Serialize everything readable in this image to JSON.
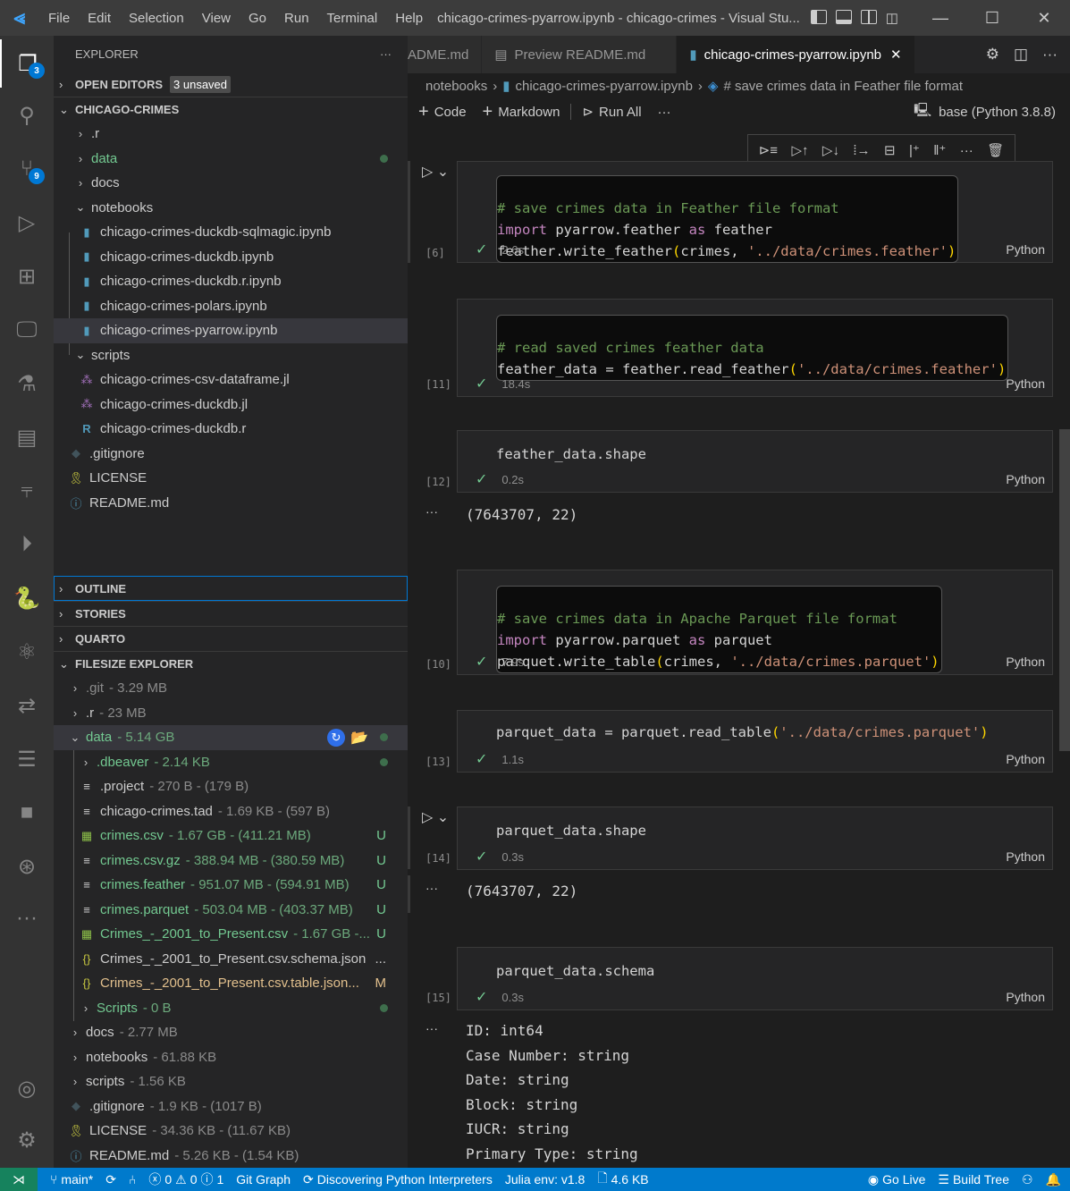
{
  "titlebar": {
    "menu": [
      "File",
      "Edit",
      "Selection",
      "View",
      "Go",
      "Run",
      "Terminal",
      "Help"
    ],
    "title": "chicago-crimes-pyarrow.ipynb - chicago-crimes - Visual Stu..."
  },
  "activity_bar": {
    "explorer_badge": "3",
    "scm_badge": "9"
  },
  "sidebar": {
    "header": "EXPLORER",
    "open_editors": {
      "label": "OPEN EDITORS",
      "badge": "3 unsaved"
    },
    "root": "CHICAGO-CRIMES",
    "tree": [
      {
        "name": ".r",
        "type": "folder"
      },
      {
        "name": "data",
        "type": "folder",
        "status": "dot"
      },
      {
        "name": "docs",
        "type": "folder"
      },
      {
        "name": "notebooks",
        "type": "folder-open"
      },
      {
        "name": "chicago-crimes-duckdb-sqlmagic.ipynb",
        "type": "notebook"
      },
      {
        "name": "chicago-crimes-duckdb.ipynb",
        "type": "notebook"
      },
      {
        "name": "chicago-crimes-duckdb.r.ipynb",
        "type": "notebook"
      },
      {
        "name": "chicago-crimes-polars.ipynb",
        "type": "notebook"
      },
      {
        "name": "chicago-crimes-pyarrow.ipynb",
        "type": "notebook",
        "selected": true
      },
      {
        "name": "scripts",
        "type": "folder-open"
      },
      {
        "name": "chicago-crimes-csv-dataframe.jl",
        "type": "julia"
      },
      {
        "name": "chicago-crimes-duckdb.jl",
        "type": "julia"
      },
      {
        "name": "chicago-crimes-duckdb.r",
        "type": "r"
      },
      {
        "name": ".gitignore",
        "type": "git"
      },
      {
        "name": "LICENSE",
        "type": "license"
      },
      {
        "name": "README.md",
        "type": "info"
      }
    ],
    "sections": [
      "OUTLINE",
      "STORIES",
      "QUARTO",
      "FILESIZE EXPLORER"
    ],
    "filesize": [
      {
        "name": ".git",
        "size": "- 3.29 MB"
      },
      {
        "name": ".r",
        "size": "- 23 MB"
      },
      {
        "name": "data",
        "size": "- 5.14 GB"
      },
      {
        "name": ".dbeaver",
        "size": "- 2.14 KB"
      },
      {
        "name": ".project",
        "size": "-  270 B - (179 B)"
      },
      {
        "name": "chicago-crimes.tad",
        "size": "-  1.69 KB - (597 B)"
      },
      {
        "name": "crimes.csv",
        "size": "-  1.67 GB - (411.21 MB)",
        "status": "U"
      },
      {
        "name": "crimes.csv.gz",
        "size": "-  388.94 MB - (380.59 MB)",
        "status": "U"
      },
      {
        "name": "crimes.feather",
        "size": "-  951.07 MB - (594.91 MB)",
        "status": "U"
      },
      {
        "name": "crimes.parquet",
        "size": "-  503.04 MB - (403.37 MB)",
        "status": "U"
      },
      {
        "name": "Crimes_-_2001_to_Present.csv",
        "size": "-  1.67 GB -...",
        "status": "U"
      },
      {
        "name": "Crimes_-_2001_to_Present.csv.schema.json",
        "size": "",
        "status": "..."
      },
      {
        "name": "Crimes_-_2001_to_Present.csv.table.json...",
        "size": "",
        "status": "M"
      },
      {
        "name": "Scripts",
        "size": "- 0 B"
      },
      {
        "name": "docs",
        "size": "- 2.77 MB"
      },
      {
        "name": "notebooks",
        "size": "- 61.88 KB"
      },
      {
        "name": "scripts",
        "size": "- 1.56 KB"
      },
      {
        "name": ".gitignore",
        "size": "-  1.9 KB - (1017 B)"
      },
      {
        "name": "LICENSE",
        "size": "-  34.36 KB - (11.67 KB)"
      },
      {
        "name": "README.md",
        "size": "-  5.26 KB - (1.54 KB)"
      }
    ]
  },
  "editor": {
    "tabs": [
      {
        "label": "ADME.md"
      },
      {
        "label": "Preview README.md"
      },
      {
        "label": "chicago-crimes-pyarrow.ipynb",
        "active": true
      }
    ],
    "breadcrumb": [
      "notebooks",
      "chicago-crimes-pyarrow.ipynb",
      "# save crimes data in Feather file format"
    ],
    "toolbar": {
      "code": "Code",
      "markdown": "Markdown",
      "run_all": "Run All",
      "kernel": "base (Python 3.8.8)"
    },
    "cells": [
      {
        "exec": "[6]",
        "time": "2.6s",
        "lang": "Python"
      },
      {
        "exec": "[11]",
        "time": "18.4s",
        "lang": "Python"
      },
      {
        "exec": "[12]",
        "time": "0.2s",
        "lang": "Python",
        "output": "(7643707, 22)"
      },
      {
        "exec": "[10]",
        "time": "7.9s",
        "lang": "Python"
      },
      {
        "exec": "[13]",
        "time": "1.1s",
        "lang": "Python"
      },
      {
        "exec": "[14]",
        "time": "0.3s",
        "lang": "Python",
        "output": "(7643707, 22)"
      },
      {
        "exec": "[15]",
        "time": "0.3s",
        "lang": "Python"
      }
    ],
    "code": {
      "c1_l1": "# save crimes data in Feather file format",
      "c1_l2a": "import",
      "c1_l2b": " pyarrow.feather ",
      "c1_l2c": "as",
      "c1_l2d": " feather",
      "c1_l3a": "feather.write_feather",
      "c1_l3b": "(",
      "c1_l3c": "crimes, ",
      "c1_l3d": "'../data/crimes.feather'",
      "c1_l3e": ")",
      "c2_l1": "# read saved crimes feather data",
      "c2_l2a": "feather_data = feather.read_feather",
      "c2_l2b": "(",
      "c2_l2c": "'../data/crimes.feather'",
      "c2_l2d": ")",
      "c3_l1": "feather_data.shape",
      "c4_l1": "# save crimes data in Apache Parquet file format",
      "c4_l2a": "import",
      "c4_l2b": " pyarrow.parquet ",
      "c4_l2c": "as",
      "c4_l2d": " parquet",
      "c4_l3a": "parquet.write_table",
      "c4_l3b": "(",
      "c4_l3c": "crimes, ",
      "c4_l3d": "'../data/crimes.parquet'",
      "c4_l3e": ")",
      "c5_l1a": "parquet_data = parquet.read_table",
      "c5_l1b": "(",
      "c5_l1c": "'../data/crimes.parquet'",
      "c5_l1d": ")",
      "c6_l1": "parquet_data.shape",
      "c7_l1": "parquet_data.schema"
    },
    "schema_output": [
      "ID: int64",
      "Case Number: string",
      "Date: string",
      "Block: string",
      "IUCR: string",
      "Primary Type: string"
    ]
  },
  "statusbar": {
    "branch": "main*",
    "errors": "0",
    "warnings": "0",
    "info": "1",
    "git_graph": "Git Graph",
    "interpreters": "Discovering Python Interpreters",
    "julia": "Julia env: v1.8",
    "filesize": "4.6 KB",
    "go_live": "Go Live",
    "build_tree": "Build Tree"
  }
}
